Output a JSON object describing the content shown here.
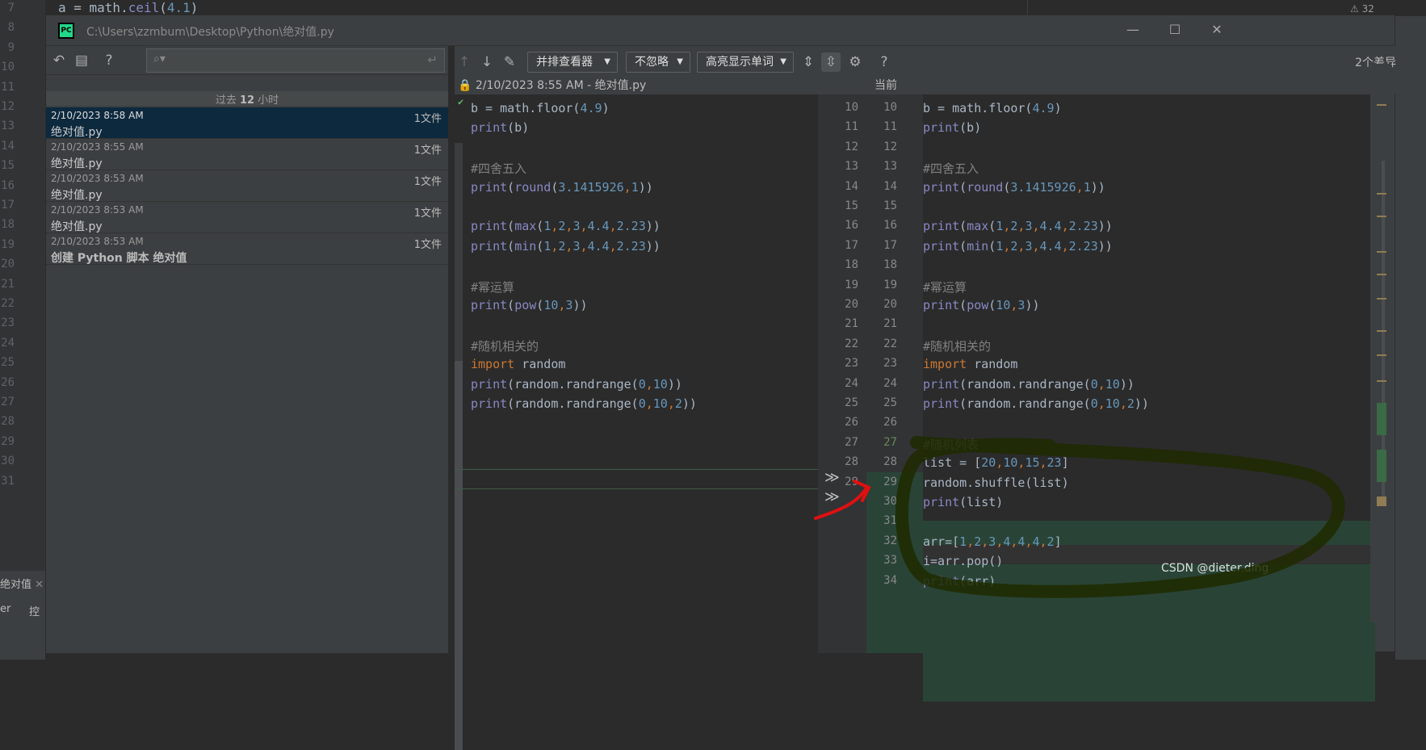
{
  "background_editor": {
    "code_line": "a = math.ceil(4.1)",
    "code_parts": [
      "a = math.",
      "ceil",
      "(",
      "4.1",
      ")"
    ],
    "line_numbers": [
      "7",
      "8",
      "9",
      "10",
      "11",
      "12",
      "13",
      "14",
      "15",
      "16",
      "17",
      "18",
      "19",
      "20",
      "21",
      "22",
      "23",
      "24",
      "25",
      "26",
      "27",
      "28",
      "29",
      "30",
      "31"
    ],
    "warning_count": "32",
    "tab_name": "绝对值",
    "bottom_labels": [
      "er",
      "控"
    ]
  },
  "dialog": {
    "title": "C:\\Users\\zzmbum\\Desktop\\Python\\绝对值.py",
    "logo_text": "PC"
  },
  "history": {
    "group_header_prefix": "过去 ",
    "group_header_bold": "12",
    "group_header_suffix": " 小时",
    "entries": [
      {
        "date": "2/10/2023 8:58 AM",
        "count": "1文件",
        "name": "绝对值.py",
        "selected": true
      },
      {
        "date": "2/10/2023 8:55 AM",
        "count": "1文件",
        "name": "绝对值.py",
        "selected": false
      },
      {
        "date": "2/10/2023 8:53 AM",
        "count": "1文件",
        "name": "绝对值.py",
        "selected": false
      },
      {
        "date": "2/10/2023 8:53 AM",
        "count": "1文件",
        "name": "绝对值.py",
        "selected": false
      },
      {
        "date": "2/10/2023 8:53 AM",
        "count": "1文件",
        "name": "创建 Python 脚本 绝对值",
        "selected": false
      }
    ]
  },
  "toolbar": {
    "viewer_combo": "并排查看器",
    "ignore_combo": "不忽略",
    "highlight_combo": "高亮显示单词",
    "help": "?",
    "diff_count": "2个差异"
  },
  "diff": {
    "left_header": "2/10/2023 8:55 AM - 绝对值.py",
    "right_header": "当前",
    "left_lines": [
      "b = math.floor(4.9)",
      "print(b)",
      "",
      "#四舍五入",
      "print(round(3.1415926,1))",
      "",
      "print(max(1,2,3,4.4,2.23))",
      "print(min(1,2,3,4.4,2.23))",
      "",
      "#幂运算",
      "print(pow(10,3))",
      "",
      "#随机相关的",
      "import random",
      "print(random.randrange(0,10))",
      "print(random.randrange(0,10,2))"
    ],
    "gutter_left_numbers": [
      "10",
      "11",
      "12",
      "13",
      "14",
      "15",
      "16",
      "17",
      "18",
      "19",
      "20",
      "21",
      "22",
      "23",
      "24",
      "25",
      "26",
      "27",
      "28",
      "29"
    ],
    "gutter_right_numbers": [
      "10",
      "11",
      "12",
      "13",
      "14",
      "15",
      "16",
      "17",
      "18",
      "19",
      "20",
      "21",
      "22",
      "23",
      "24",
      "25",
      "26",
      "27",
      "28",
      "29",
      "30",
      "31",
      "32",
      "33",
      "34"
    ],
    "right_lines": [
      "b = math.floor(4.9)",
      "print(b)",
      "",
      "#四舍五入",
      "print(round(3.1415926,1))",
      "",
      "print(max(1,2,3,4.4,2.23))",
      "print(min(1,2,3,4.4,2.23))",
      "",
      "#幂运算",
      "print(pow(10,3))",
      "",
      "#随机相关的",
      "import random",
      "print(random.randrange(0,10))",
      "print(random.randrange(0,10,2))",
      "",
      "#随机列表",
      "list = [20,10,15,23]",
      "random.shuffle(list)",
      "print(list)",
      "",
      "arr=[1,2,3,4,4,4,2]",
      "i=arr.pop()",
      "print(arr)"
    ]
  },
  "watermark": "CSDN @dieter.ding",
  "colors": {
    "added_bg": "#294436",
    "keyword": "#cc7832",
    "number": "#6897bb",
    "comment": "#808080",
    "selected_row": "#0d293e",
    "annotation_red": "#e01010",
    "annotation_dark": "#1e2a00"
  }
}
